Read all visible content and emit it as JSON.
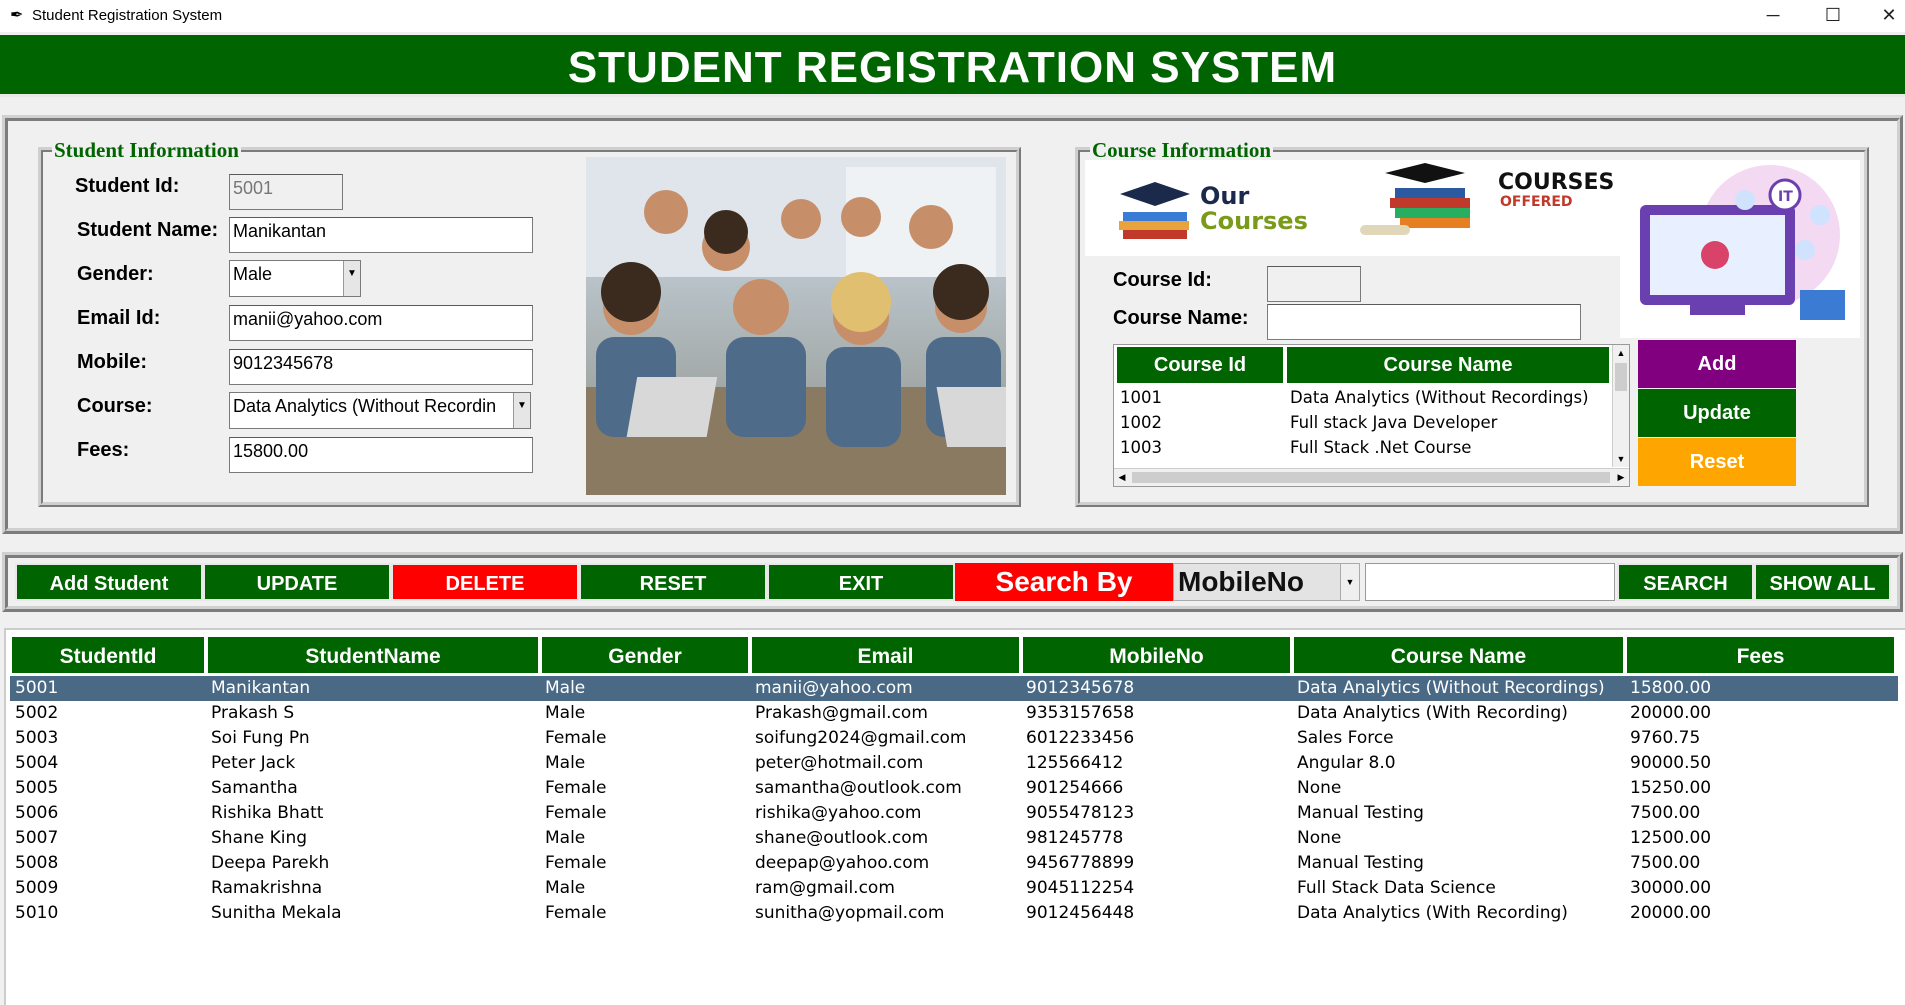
{
  "window": {
    "title": "Student Registration System"
  },
  "header": {
    "title": "STUDENT REGISTRATION SYSTEM"
  },
  "student_info": {
    "legend": "Student Information",
    "labels": {
      "id": "Student Id:",
      "name": "Student Name:",
      "gender": "Gender:",
      "email": "Email Id:",
      "mobile": "Mobile:",
      "course": "Course:",
      "fees": "Fees:"
    },
    "values": {
      "id": "5001",
      "name": "Manikantan",
      "gender": "Male",
      "email": "manii@yahoo.com",
      "mobile": "9012345678",
      "course": "Data Analytics (Without Recordin",
      "fees": "15800.00"
    }
  },
  "course_info": {
    "legend": "Course Information",
    "banner1": {
      "line1": "Our",
      "line2": "Courses"
    },
    "banner2": {
      "line1": "COURSES",
      "line2": "OFFERED"
    },
    "labels": {
      "id": "Course Id:",
      "name": "Course Name:"
    },
    "values": {
      "id": "",
      "name": ""
    },
    "table": {
      "headers": [
        "Course Id",
        "Course Name"
      ],
      "rows": [
        {
          "id": "1001",
          "name": "Data Analytics (Without Recordings)"
        },
        {
          "id": "1002",
          "name": "Full stack Java Developer"
        },
        {
          "id": "1003",
          "name": "Full Stack .Net Course"
        }
      ]
    },
    "buttons": {
      "add": "Add",
      "update": "Update",
      "reset": "Reset"
    }
  },
  "actions": {
    "add": "Add Student",
    "update": "UPDATE",
    "delete": "DELETE",
    "reset": "RESET",
    "exit": "EXIT",
    "search_by_label": "Search By",
    "search_by_value": "MobileNo",
    "search_value": "",
    "search": "SEARCH",
    "show_all": "SHOW ALL"
  },
  "students": {
    "headers": [
      "StudentId",
      "StudentName",
      "Gender",
      "Email",
      "MobileNo",
      "Course Name",
      "Fees"
    ],
    "rows": [
      [
        "5001",
        "Manikantan",
        "Male",
        "manii@yahoo.com",
        "9012345678",
        "Data Analytics (Without Recordings)",
        "15800.00"
      ],
      [
        "5002",
        "Prakash S",
        "Male",
        "Prakash@gmail.com",
        "9353157658",
        "Data Analytics (With Recording)",
        "20000.00"
      ],
      [
        "5003",
        "Soi Fung Pn",
        "Female",
        "soifung2024@gmail.com",
        "6012233456",
        "Sales Force",
        "9760.75"
      ],
      [
        "5004",
        "Peter Jack",
        "Male",
        "peter@hotmail.com",
        "125566412",
        "Angular 8.0",
        "90000.50"
      ],
      [
        "5005",
        "Samantha",
        "Female",
        "samantha@outlook.com",
        "901254666",
        "None",
        "15250.00"
      ],
      [
        "5006",
        "Rishika Bhatt",
        "Female",
        "rishika@yahoo.com",
        "9055478123",
        "Manual Testing",
        "7500.00"
      ],
      [
        "5007",
        "Shane King",
        "Male",
        "shane@outlook.com",
        "981245778",
        "None",
        "12500.00"
      ],
      [
        "5008",
        "Deepa Parekh",
        "Female",
        "deepap@yahoo.com",
        "9456778899",
        "Manual Testing",
        "7500.00"
      ],
      [
        "5009",
        "Ramakrishna",
        "Male",
        "ram@gmail.com",
        "9045112254",
        "Full Stack Data Science",
        "30000.00"
      ],
      [
        "5010",
        "Sunitha Mekala",
        "Female",
        "sunitha@yopmail.com",
        "9012456448",
        "Data Analytics (With Recording)",
        "20000.00"
      ]
    ]
  },
  "colors": {
    "green": "#006400",
    "red": "#ff0000",
    "purple": "#800080",
    "orange": "#ffa500",
    "selected_row": "#4a6984"
  }
}
